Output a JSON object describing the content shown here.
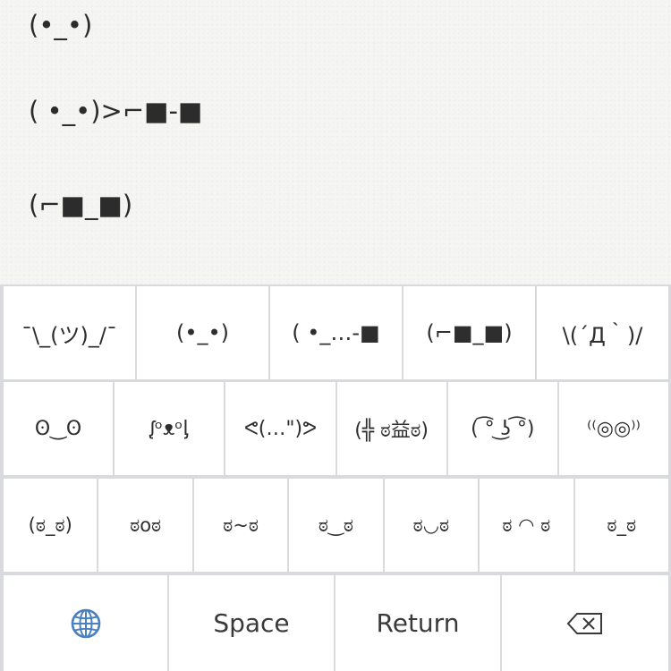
{
  "document": {
    "lines": [
      "(•_•)",
      "( •_•)>⌐■-■",
      "(⌐■_■)"
    ]
  },
  "keyboard": {
    "row1": [
      "¯\\_(ツ)_/¯",
      "(•_•)",
      "( •_…-■",
      "(⌐■_■)",
      "\\(´Д｀)/"
    ],
    "row2": [
      "ʘ‿ʘ",
      "ᶘᵒᴥᵒᶅ",
      "ᕙ(…\")ᕗ",
      "(╬ ಠ益ಠ)",
      "( ͡° ͜ʖ ͡°)",
      "⁽⁽◎◎⁾⁾"
    ],
    "row3": [
      "(ಠ_ಠ)",
      "ಠoಠ",
      "ಠ~ಠ",
      "ಠ‿ಠ",
      "ಠ◡ಠ",
      "ಠ ◠ ಠ",
      "ಠ_ಠ"
    ],
    "space_label": "Space",
    "return_label": "Return",
    "globe_icon": "globe-icon",
    "delete_icon": "backspace-icon",
    "globe_color": "#4a7fc1"
  }
}
